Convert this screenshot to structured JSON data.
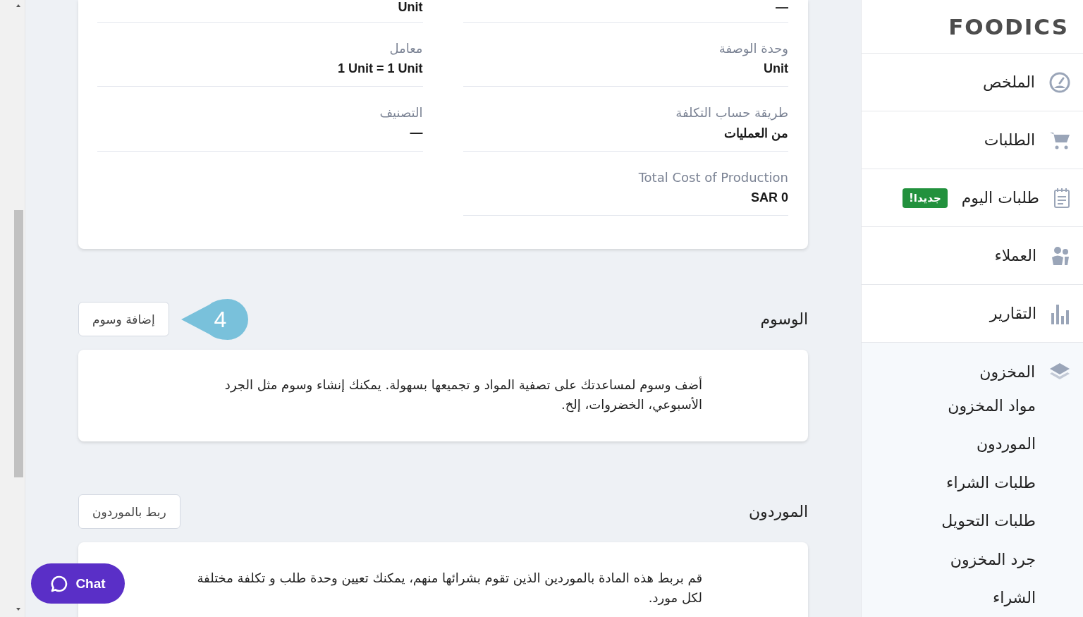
{
  "details": {
    "rows": [
      {
        "cells": [
          {
            "value": "—"
          },
          {
            "value": "Unit"
          }
        ]
      },
      {
        "cells": [
          {
            "label": "وحدة الوصفة",
            "value": "Unit"
          },
          {
            "label": "معامل",
            "value": "1 Unit = 1 Unit"
          }
        ]
      },
      {
        "cells": [
          {
            "label": "طريقة حساب التكلفة",
            "value": "من العمليات"
          },
          {
            "label": "التصنيف",
            "value": "—"
          }
        ]
      },
      {
        "cells": [
          {
            "label": "Total Cost of Production",
            "value": "SAR 0"
          }
        ]
      }
    ]
  },
  "tags_section": {
    "title": "الوسوم",
    "button": "إضافة وسوم",
    "step_marker": "4",
    "description": "أضف وسوم لمساعدتك على تصفية المواد و تجميعها بسهولة. يمكنك إنشاء وسوم مثل الجرد الأسبوعي، الخضروات، إلخ."
  },
  "suppliers_section": {
    "title": "الموردون",
    "button": "ربط بالموردون",
    "description": "قم بربط هذه المادة بالموردين الذين تقوم بشرائها منهم، يمكنك تعيين وحدة طلب و تكلفة مختلفة لكل مورد."
  },
  "chat_button": {
    "label": "Chat"
  },
  "sidebar": {
    "logo": "FOODICS",
    "items": [
      {
        "label": "الملخص"
      },
      {
        "label": "الطلبات"
      },
      {
        "label": "طلبات اليوم",
        "badge": "جديدا!"
      },
      {
        "label": "العملاء"
      },
      {
        "label": "التقارير"
      },
      {
        "label": "المخزون",
        "expanded": true,
        "children": [
          {
            "label": "مواد المخزون"
          },
          {
            "label": "الموردون"
          },
          {
            "label": "طلبات الشراء"
          },
          {
            "label": "طلبات التحويل"
          },
          {
            "label": "جرد المخزون"
          },
          {
            "label": "الشراء"
          }
        ]
      }
    ]
  }
}
